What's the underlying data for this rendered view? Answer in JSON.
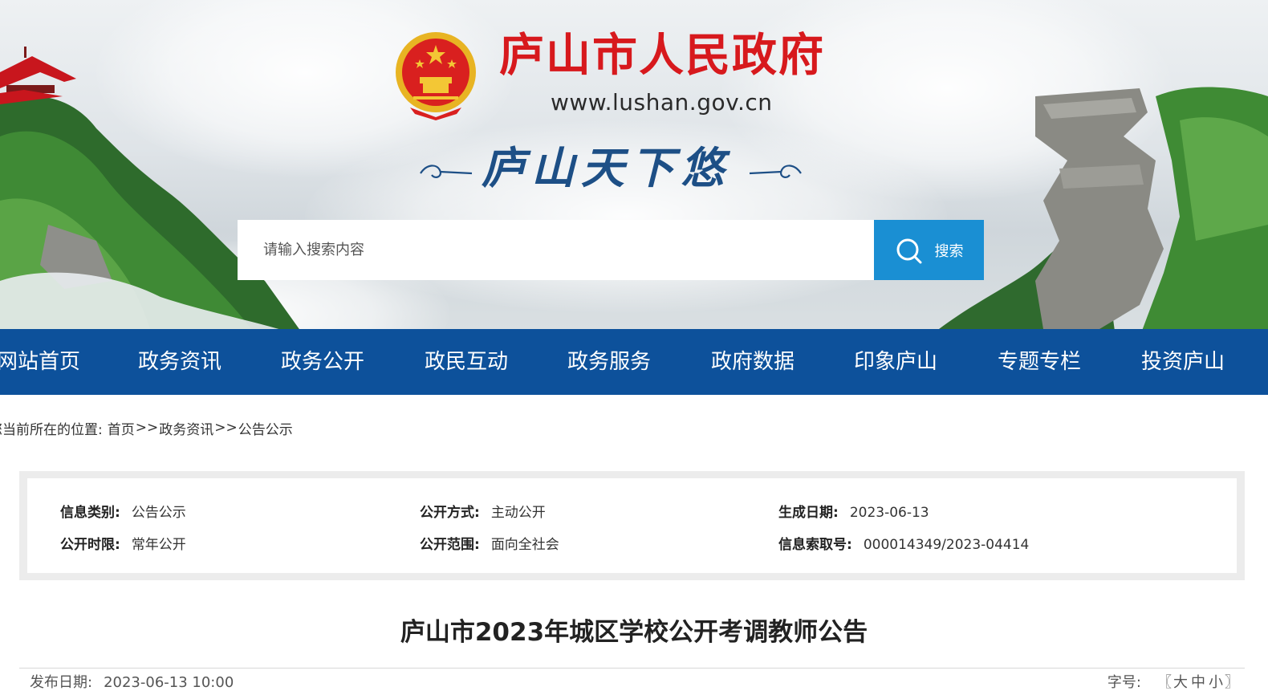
{
  "header": {
    "site_title": "庐山市人民政府",
    "site_url": "www.lushan.gov.cn",
    "slogan": "庐山天下悠",
    "brand_red": "#d7191d",
    "brand_blue": "#0d519b"
  },
  "search": {
    "placeholder": "请输入搜索内容",
    "button_label": "搜索",
    "button_icon": "search-icon",
    "button_color": "#1a8fd3"
  },
  "nav": {
    "items": [
      {
        "label": "网站首页"
      },
      {
        "label": "政务资讯"
      },
      {
        "label": "政务公开"
      },
      {
        "label": "政民互动"
      },
      {
        "label": "政务服务"
      },
      {
        "label": "政府数据"
      },
      {
        "label": "印象庐山"
      },
      {
        "label": "专题专栏"
      },
      {
        "label": "投资庐山"
      }
    ]
  },
  "breadcrumb": {
    "prefix": "您当前所在的位置:",
    "items": [
      "首页",
      "政务资讯",
      "公告公示"
    ],
    "separator": ">>"
  },
  "info": {
    "category_label": "信息类别:",
    "category_value": "公告公示",
    "method_label": "公开方式:",
    "method_value": "主动公开",
    "created_label": "生成日期:",
    "created_value": "2023-06-13",
    "period_label": "公开时限:",
    "period_value": "常年公开",
    "scope_label": "公开范围:",
    "scope_value": "面向全社会",
    "index_label": "信息索取号:",
    "index_value": "000014349/2023-04414"
  },
  "article": {
    "title": "庐山市2023年城区学校公开考调教师公告",
    "pub_label": "发布日期:",
    "pub_value": "2023-06-13 10:00",
    "font_label": "字号:",
    "font_open": "〖",
    "font_large": "大",
    "font_medium": "中",
    "font_small": "小",
    "font_close": "〗"
  }
}
